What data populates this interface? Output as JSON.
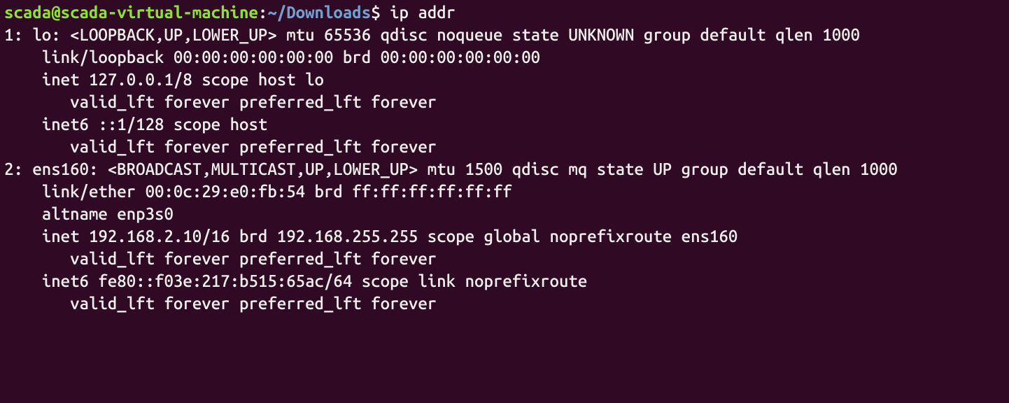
{
  "prompt": {
    "user": "scada@scada-virtual-machine",
    "colon": ":",
    "path": "~/Downloads",
    "dollar": "$ ",
    "command": "ip addr"
  },
  "output": {
    "l1": "1: lo: <LOOPBACK,UP,LOWER_UP> mtu 65536 qdisc noqueue state UNKNOWN group default qlen 1000",
    "l2": "    link/loopback 00:00:00:00:00:00 brd 00:00:00:00:00:00",
    "l3": "    inet 127.0.0.1/8 scope host lo",
    "l4": "       valid_lft forever preferred_lft forever",
    "l5": "    inet6 ::1/128 scope host ",
    "l6": "       valid_lft forever preferred_lft forever",
    "l7": "2: ens160: <BROADCAST,MULTICAST,UP,LOWER_UP> mtu 1500 qdisc mq state UP group default qlen 1000",
    "l8": "    link/ether 00:0c:29:e0:fb:54 brd ff:ff:ff:ff:ff:ff",
    "l9": "    altname enp3s0",
    "l10": "    inet 192.168.2.10/16 brd 192.168.255.255 scope global noprefixroute ens160",
    "l11": "       valid_lft forever preferred_lft forever",
    "l12": "    inet6 fe80::f03e:217:b515:65ac/64 scope link noprefixroute ",
    "l13": "       valid_lft forever preferred_lft forever"
  }
}
